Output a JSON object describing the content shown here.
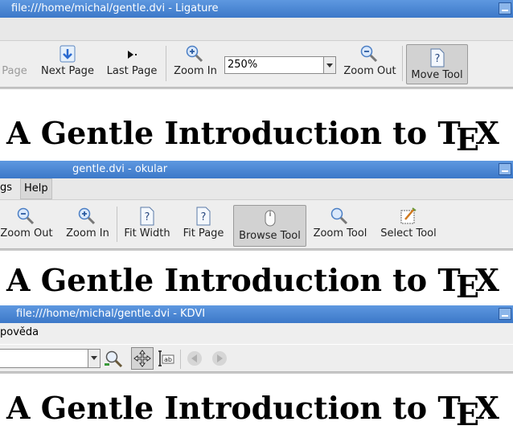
{
  "ligature": {
    "title": "file:///home/michal/gentle.dvi - Ligature",
    "toolbar": {
      "prev_label": "Page",
      "next_label": "Next Page",
      "last_label": "Last Page",
      "zoom_in_label": "Zoom In",
      "zoom_value": "250%",
      "zoom_out_label": "Zoom Out",
      "move_tool_label": "Move Tool"
    },
    "doc_text": "A Gentle Introduction to T",
    "tex_e": "E",
    "tex_x": "X"
  },
  "okular": {
    "title": "gentle.dvi - okular",
    "menu": {
      "settings_partial": "gs",
      "help": "Help"
    },
    "toolbar": {
      "zoom_out_label": "Zoom Out",
      "zoom_in_label": "Zoom In",
      "fit_width_label": "Fit Width",
      "fit_page_label": "Fit Page",
      "browse_tool_label": "Browse Tool",
      "zoom_tool_label": "Zoom Tool",
      "select_tool_label": "Select Tool"
    },
    "doc_text": "A Gentle Introduction to T",
    "tex_e": "E",
    "tex_x": "X"
  },
  "kdvi": {
    "title": "file:///home/michal/gentle.dvi - KDVI",
    "menu": {
      "help_partial": "pověda"
    },
    "toolbar": {
      "zoom_value": ""
    },
    "doc_text": "A Gentle Introduction to T",
    "tex_e": "E",
    "tex_x": "X"
  }
}
